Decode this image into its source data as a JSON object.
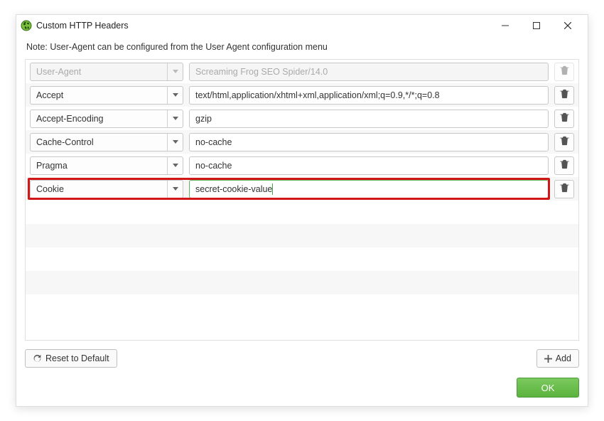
{
  "window": {
    "title": "Custom HTTP Headers"
  },
  "note": "Note: User-Agent can be configured from the User Agent configuration menu",
  "rows": [
    {
      "name": "User-Agent",
      "value": "Screaming Frog SEO Spider/14.0",
      "disabled": true,
      "highlight": false
    },
    {
      "name": "Accept",
      "value": "text/html,application/xhtml+xml,application/xml;q=0.9,*/*;q=0.8",
      "disabled": false,
      "highlight": false
    },
    {
      "name": "Accept-Encoding",
      "value": "gzip",
      "disabled": false,
      "highlight": false
    },
    {
      "name": "Cache-Control",
      "value": "no-cache",
      "disabled": false,
      "highlight": false
    },
    {
      "name": "Pragma",
      "value": "no-cache",
      "disabled": false,
      "highlight": false
    },
    {
      "name": "Cookie",
      "value": "secret-cookie-value",
      "disabled": false,
      "highlight": true
    }
  ],
  "buttons": {
    "reset": "Reset to Default",
    "add": "Add",
    "ok": "OK"
  }
}
